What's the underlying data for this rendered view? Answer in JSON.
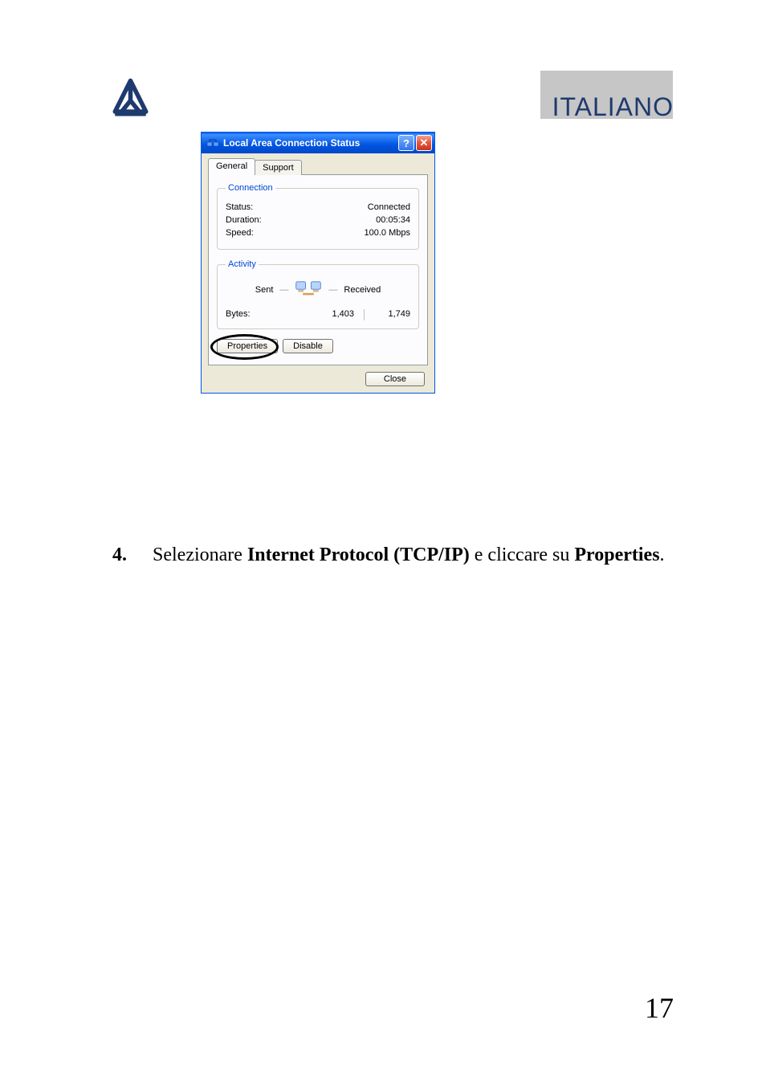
{
  "language_label": "ITALIANO",
  "dialog": {
    "title": "Local Area Connection Status",
    "tabs": {
      "general": "General",
      "support": "Support"
    },
    "connection": {
      "legend": "Connection",
      "status_label": "Status:",
      "status_value": "Connected",
      "duration_label": "Duration:",
      "duration_value": "00:05:34",
      "speed_label": "Speed:",
      "speed_value": "100.0 Mbps"
    },
    "activity": {
      "legend": "Activity",
      "sent_label": "Sent",
      "received_label": "Received",
      "bytes_label": "Bytes:",
      "bytes_sent": "1,403",
      "bytes_received": "1,749"
    },
    "buttons": {
      "properties": "Properties",
      "disable": "Disable",
      "close": "Close"
    }
  },
  "instruction": {
    "number": "4.",
    "pre": "Selezionare ",
    "bold1": "Internet Protocol (TCP/IP)",
    "mid": " e cliccare su ",
    "bold2": "Properties",
    "post": "."
  },
  "page_number": "17"
}
